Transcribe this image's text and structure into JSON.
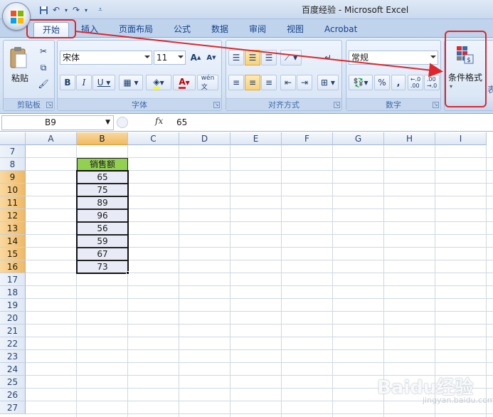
{
  "window": {
    "title": "百度经验 - Microsoft Excel"
  },
  "tabs": [
    "开始",
    "插入",
    "页面布局",
    "公式",
    "数据",
    "审阅",
    "视图",
    "Acrobat"
  ],
  "ribbon": {
    "clipboard": {
      "paste_label": "粘贴",
      "group_label": "剪贴板"
    },
    "font": {
      "font_name": "宋体",
      "font_size": "11",
      "group_label": "字体"
    },
    "alignment": {
      "group_label": "对齐方式"
    },
    "number": {
      "format": "常规",
      "group_label": "数字",
      "percent": "%",
      "comma": ","
    },
    "styles": {
      "cond_format_label": "条件格式",
      "cut_text": "表"
    }
  },
  "formula_bar": {
    "name_box": "B9",
    "fx": "fx",
    "value": "65"
  },
  "grid": {
    "columns": [
      "A",
      "B",
      "C",
      "D",
      "E",
      "F",
      "G",
      "H",
      "I"
    ],
    "rows": [
      "7",
      "8",
      "9",
      "10",
      "11",
      "12",
      "13",
      "14",
      "15",
      "16",
      "17",
      "18",
      "19",
      "20",
      "21",
      "22",
      "23",
      "24",
      "25",
      "26",
      "27"
    ],
    "header_cell": "销售额",
    "values": [
      "65",
      "75",
      "89",
      "96",
      "56",
      "59",
      "67",
      "73"
    ]
  },
  "watermark": {
    "text": "Baidu经验",
    "sub": "jingyan.baidu.com"
  },
  "colors": {
    "highlight_red": "#e0262b",
    "header_green": "#92d050",
    "data_fill": "#e8eaf6",
    "selected_header": "#f1b962"
  }
}
